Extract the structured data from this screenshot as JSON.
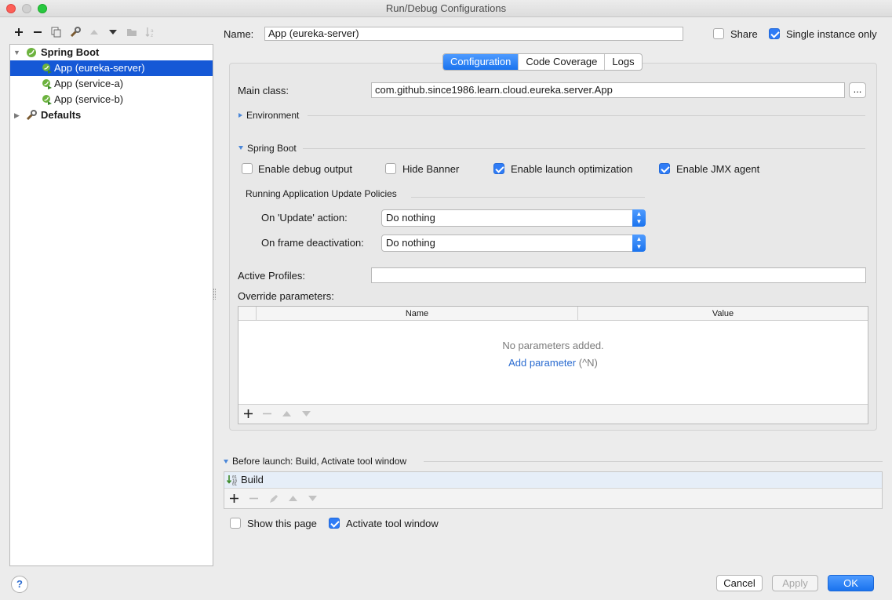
{
  "window": {
    "title": "Run/Debug Configurations"
  },
  "toolbar": {
    "icons": [
      "add-icon",
      "remove-icon",
      "copy-icon",
      "wrench-icon",
      "move-up-icon",
      "move-down-icon",
      "folder-icon",
      "sort-icon"
    ]
  },
  "tree": {
    "items": [
      {
        "label": "Spring Boot",
        "icon": "spring-boot-icon",
        "expanded": true
      },
      {
        "label": "App (eureka-server)",
        "icon": "spring-app-icon",
        "selected": true
      },
      {
        "label": "App (service-a)",
        "icon": "spring-app-icon"
      },
      {
        "label": "App (service-b)",
        "icon": "spring-app-icon"
      },
      {
        "label": "Defaults",
        "icon": "wrench-icon",
        "expanded": false
      }
    ]
  },
  "header": {
    "name_label": "Name:",
    "name_value": "App (eureka-server)",
    "share_label": "Share",
    "share_checked": false,
    "single_instance_label": "Single instance only",
    "single_instance_checked": true
  },
  "tabs": [
    "Configuration",
    "Code Coverage",
    "Logs"
  ],
  "config": {
    "main_class_label": "Main class:",
    "main_class_value": "com.github.since1986.learn.cloud.eureka.server.App",
    "browse_label": "...",
    "environment_label": "Environment",
    "spring_boot_label": "Spring Boot",
    "options": [
      {
        "label": "Enable debug output",
        "checked": false
      },
      {
        "label": "Hide Banner",
        "checked": false
      },
      {
        "label": "Enable launch optimization",
        "checked": true
      },
      {
        "label": "Enable JMX agent",
        "checked": true
      }
    ],
    "policies_label": "Running Application Update Policies",
    "update_action_label": "On 'Update' action:",
    "update_action_value": "Do nothing",
    "frame_deactivation_label": "On frame deactivation:",
    "frame_deactivation_value": "Do nothing",
    "active_profiles_label": "Active Profiles:",
    "active_profiles_value": "",
    "override_label": "Override parameters:",
    "table": {
      "columns": [
        "Name",
        "Value"
      ],
      "empty_text": "No parameters added.",
      "add_link": "Add parameter",
      "add_shortcut": "(^N)"
    }
  },
  "before_launch": {
    "label": "Before launch: Build, Activate tool window",
    "items": [
      {
        "label": "Build",
        "icon": "build-icon"
      }
    ],
    "show_page_label": "Show this page",
    "show_page_checked": false,
    "activate_tool_label": "Activate tool window",
    "activate_tool_checked": true
  },
  "buttons": {
    "help": "?",
    "cancel": "Cancel",
    "apply": "Apply",
    "ok": "OK"
  },
  "colors": {
    "accent": "#1a73ee",
    "selection": "#1558d6",
    "spring_green": "#6db33f"
  }
}
